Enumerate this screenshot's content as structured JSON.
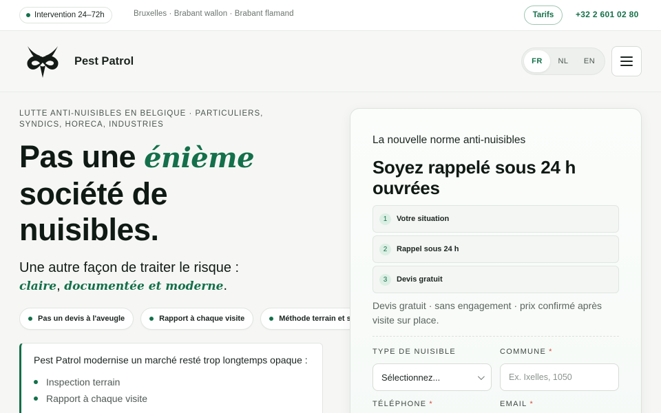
{
  "topbar": {
    "intervention": "Intervention 24–72h",
    "regions": "Bruxelles · Brabant wallon · Brabant flamand",
    "tarifs_label": "Tarifs",
    "phone": "+32 2 601 02 80"
  },
  "header": {
    "brand": "Pest Patrol",
    "languages": [
      "FR",
      "NL",
      "EN"
    ],
    "active_language": "FR"
  },
  "hero": {
    "eyebrow": "LUTTE ANTI-NUISIBLES EN BELGIQUE · PARTICULIERS, SYNDICS, HORECA, INDUSTRIES",
    "title_part1": "Pas une ",
    "title_accent": "énième",
    "title_part2": " société de nuisibles.",
    "subtitle_part1": "Une autre façon de traiter le risque :",
    "subtitle_accent1": "claire",
    "subtitle_sep": ", ",
    "subtitle_accent2": "documentée et moderne",
    "subtitle_end": ".",
    "chips": [
      "Pas un devis à l'aveugle",
      "Rapport à chaque visite",
      "Méthode terrain et sobre"
    ]
  },
  "intro": {
    "text": "Pest Patrol modernise un marché resté trop longtemps opaque :",
    "items": [
      "Inspection terrain",
      "Rapport à chaque visite"
    ]
  },
  "form": {
    "kicker": "La nouvelle norme anti-nuisibles",
    "title": "Soyez rappelé sous 24 h ouvrées",
    "steps": [
      {
        "num": "1",
        "label": "Votre situation"
      },
      {
        "num": "2",
        "label": "Rappel sous 24 h"
      },
      {
        "num": "3",
        "label": "Devis gratuit"
      }
    ],
    "note": "Devis gratuit · sans engagement · prix confirmé après visite sur place.",
    "pest_type_label": "TYPE DE NUISIBLE",
    "pest_type_value": "Sélectionnez...",
    "commune_label": "COMMUNE",
    "commune_placeholder": "Ex. Ixelles, 1050",
    "phone_label": "TÉLÉPHONE",
    "email_label": "EMAIL",
    "required_mark": "*"
  },
  "colors": {
    "accent": "#13704a",
    "text": "#101a14",
    "background": "#f6f7f5",
    "required": "#d04b3a"
  }
}
